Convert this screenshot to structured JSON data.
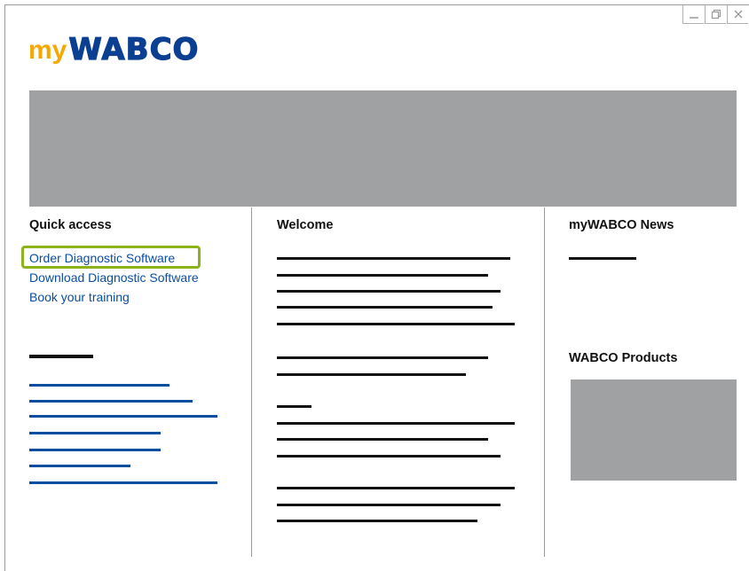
{
  "brand": {
    "logo_prefix": "my",
    "logo_name": "WABCO",
    "colors": {
      "prefix": "#f4a800",
      "name": "#0a3f92",
      "link": "#0a4ea1",
      "highlight": "#8cb31a",
      "placeholder": "#a0a1a3"
    }
  },
  "window_controls": {
    "minimize_icon": "minimize-icon",
    "restore_icon": "restore-icon",
    "close_icon": "close-icon"
  },
  "quick_access": {
    "title": "Quick access",
    "links": [
      "Order Diagnostic Software",
      "Download Diagnostic Software",
      "Book your training"
    ]
  },
  "welcome": {
    "title": "Welcome"
  },
  "news": {
    "title": "myWABCO News"
  },
  "products": {
    "title": "WABCO Products"
  }
}
